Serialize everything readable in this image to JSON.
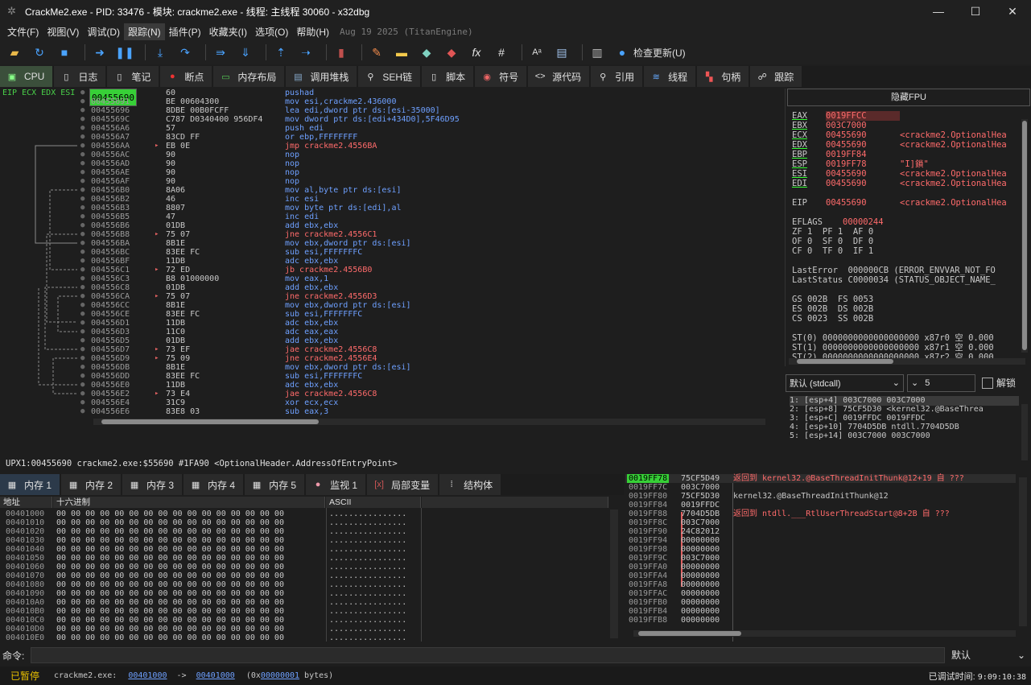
{
  "window": {
    "title": "CrackMe2.exe - PID: 33476 - 模块: crackme2.exe - 线程: 主线程 30060 - x32dbg",
    "minimize": "—",
    "maximize": "☐",
    "close": "✕"
  },
  "menu": {
    "items": [
      "文件(F)",
      "视图(V)",
      "调试(D)",
      "跟踪(N)",
      "插件(P)",
      "收藏夹(I)",
      "选项(O)",
      "帮助(H)"
    ],
    "active_index": 3,
    "date": "Aug 19 2025 (TitanEngine)"
  },
  "toolbar": {
    "update_label": "检查更新(U)",
    "icons": [
      "open-icon",
      "restart-icon",
      "stop-icon",
      "run-icon",
      "pause-icon",
      "step-into-icon",
      "step-over-icon",
      "trace-into-icon",
      "trace-over-icon",
      "execute-till-return-icon",
      "run-to-user-code-icon",
      "scylla-icon",
      "patch-icon",
      "comment-icon",
      "label-icon",
      "bookmark-icon",
      "function-icon",
      "hash-icon",
      "font-icon",
      "calculator-icon",
      "memo-icon",
      "globe-icon"
    ]
  },
  "tabs": [
    {
      "label": "CPU",
      "icon": "cpu-icon"
    },
    {
      "label": "日志",
      "icon": "log-icon"
    },
    {
      "label": "笔记",
      "icon": "notes-icon"
    },
    {
      "label": "断点",
      "icon": "breakpoint-icon"
    },
    {
      "label": "内存布局",
      "icon": "memory-map-icon"
    },
    {
      "label": "调用堆栈",
      "icon": "call-stack-icon"
    },
    {
      "label": "SEH链",
      "icon": "seh-icon"
    },
    {
      "label": "脚本",
      "icon": "script-icon"
    },
    {
      "label": "符号",
      "icon": "symbols-icon"
    },
    {
      "label": "源代码",
      "icon": "source-icon"
    },
    {
      "label": "引用",
      "icon": "references-icon"
    },
    {
      "label": "线程",
      "icon": "threads-icon"
    },
    {
      "label": "句柄",
      "icon": "handles-icon"
    },
    {
      "label": "跟踪",
      "icon": "trace-icon"
    }
  ],
  "disasm": {
    "reg_label": "EIP ECX EDX ESI",
    "rows": [
      {
        "addr": "00455690",
        "bytes": "60",
        "instr": "pushad",
        "type": "normal",
        "selected": true
      },
      {
        "addr": "00455691",
        "bytes": "BE 00604300",
        "instr": "mov esi,crackme2.436000",
        "type": "normal"
      },
      {
        "addr": "00455696",
        "bytes": "8DBE 00B0FCFF",
        "instr": "lea edi,dword ptr ds:[esi-35000]",
        "type": "normal"
      },
      {
        "addr": "0045569C",
        "bytes": "C787 D0340400 956DF4",
        "instr": "mov dword ptr ds:[edi+434D0],5F46D95",
        "type": "normal"
      },
      {
        "addr": "004556A6",
        "bytes": "57",
        "instr": "push edi",
        "type": "normal"
      },
      {
        "addr": "004556A7",
        "bytes": "83CD FF",
        "instr": "or ebp,FFFFFFFF",
        "type": "normal"
      },
      {
        "addr": "004556AA",
        "bytes": "EB 0E",
        "instr": "jmp crackme2.4556BA",
        "type": "jump"
      },
      {
        "addr": "004556AC",
        "bytes": "90",
        "instr": "nop",
        "type": "normal"
      },
      {
        "addr": "004556AD",
        "bytes": "90",
        "instr": "nop",
        "type": "normal"
      },
      {
        "addr": "004556AE",
        "bytes": "90",
        "instr": "nop",
        "type": "normal"
      },
      {
        "addr": "004556AF",
        "bytes": "90",
        "instr": "nop",
        "type": "normal"
      },
      {
        "addr": "004556B0",
        "bytes": "8A06",
        "instr": "mov al,byte ptr ds:[esi]",
        "type": "normal"
      },
      {
        "addr": "004556B2",
        "bytes": "46",
        "instr": "inc esi",
        "type": "normal"
      },
      {
        "addr": "004556B3",
        "bytes": "8807",
        "instr": "mov byte ptr ds:[edi],al",
        "type": "normal"
      },
      {
        "addr": "004556B5",
        "bytes": "47",
        "instr": "inc edi",
        "type": "normal"
      },
      {
        "addr": "004556B6",
        "bytes": "01DB",
        "instr": "add ebx,ebx",
        "type": "normal"
      },
      {
        "addr": "004556B8",
        "bytes": "75 07",
        "instr": "jne crackme2.4556C1",
        "type": "jump"
      },
      {
        "addr": "004556BA",
        "bytes": "8B1E",
        "instr": "mov ebx,dword ptr ds:[esi]",
        "type": "normal"
      },
      {
        "addr": "004556BC",
        "bytes": "83EE FC",
        "instr": "sub esi,FFFFFFFC",
        "type": "normal"
      },
      {
        "addr": "004556BF",
        "bytes": "11DB",
        "instr": "adc ebx,ebx",
        "type": "normal"
      },
      {
        "addr": "004556C1",
        "bytes": "72 ED",
        "instr": "jb crackme2.4556B0",
        "type": "jump"
      },
      {
        "addr": "004556C3",
        "bytes": "B8 01000000",
        "instr": "mov eax,1",
        "type": "normal"
      },
      {
        "addr": "004556C8",
        "bytes": "01DB",
        "instr": "add ebx,ebx",
        "type": "normal"
      },
      {
        "addr": "004556CA",
        "bytes": "75 07",
        "instr": "jne crackme2.4556D3",
        "type": "jump"
      },
      {
        "addr": "004556CC",
        "bytes": "8B1E",
        "instr": "mov ebx,dword ptr ds:[esi]",
        "type": "normal"
      },
      {
        "addr": "004556CE",
        "bytes": "83EE FC",
        "instr": "sub esi,FFFFFFFC",
        "type": "normal"
      },
      {
        "addr": "004556D1",
        "bytes": "11DB",
        "instr": "adc ebx,ebx",
        "type": "normal"
      },
      {
        "addr": "004556D3",
        "bytes": "11C0",
        "instr": "adc eax,eax",
        "type": "normal"
      },
      {
        "addr": "004556D5",
        "bytes": "01DB",
        "instr": "add ebx,ebx",
        "type": "normal"
      },
      {
        "addr": "004556D7",
        "bytes": "73 EF",
        "instr": "jae crackme2.4556C8",
        "type": "jump"
      },
      {
        "addr": "004556D9",
        "bytes": "75 09",
        "instr": "jne crackme2.4556E4",
        "type": "jump"
      },
      {
        "addr": "004556DB",
        "bytes": "8B1E",
        "instr": "mov ebx,dword ptr ds:[esi]",
        "type": "normal"
      },
      {
        "addr": "004556DD",
        "bytes": "83EE FC",
        "instr": "sub esi,FFFFFFFC",
        "type": "normal"
      },
      {
        "addr": "004556E0",
        "bytes": "11DB",
        "instr": "adc ebx,ebx",
        "type": "normal"
      },
      {
        "addr": "004556E2",
        "bytes": "73 E4",
        "instr": "jae crackme2.4556C8",
        "type": "jump"
      },
      {
        "addr": "004556E4",
        "bytes": "31C9",
        "instr": "xor ecx,ecx",
        "type": "normal"
      },
      {
        "addr": "004556E6",
        "bytes": "83E8 03",
        "instr": "sub eax,3",
        "type": "normal"
      }
    ]
  },
  "infobar": "UPX1:00455690 crackme2.exe:$55690 #1FA90 <OptionalHeader.AddressOfEntryPoint>",
  "registers": {
    "fpu_button": "隐藏FPU",
    "lines": [
      {
        "name": "EAX",
        "value": "0019FFCC",
        "comment": "",
        "changed": true,
        "hl": true
      },
      {
        "name": "EBX",
        "value": "003C7000",
        "comment": "",
        "changed": true
      },
      {
        "name": "ECX",
        "value": "00455690",
        "comment": "<crackme2.OptionalHea",
        "changed": true
      },
      {
        "name": "EDX",
        "value": "00455690",
        "comment": "<crackme2.OptionalHea",
        "changed": true
      },
      {
        "name": "EBP",
        "value": "0019FF84",
        "comment": "",
        "changed": true
      },
      {
        "name": "ESP",
        "value": "0019FF78",
        "comment": "\"I]鎖\"",
        "changed": true
      },
      {
        "name": "ESI",
        "value": "00455690",
        "comment": "<crackme2.OptionalHea",
        "changed": true
      },
      {
        "name": "EDI",
        "value": "00455690",
        "comment": "<crackme2.OptionalHea",
        "changed": true
      },
      {
        "name": "",
        "value": "",
        "comment": ""
      },
      {
        "name": "EIP",
        "value": "00455690",
        "comment": "<crackme2.OptionalHea"
      },
      {
        "name": "",
        "value": "",
        "comment": ""
      },
      {
        "name": "EFLAGS",
        "value": "00000244",
        "comment": ""
      },
      {
        "text": "ZF 1  PF 1  AF 0"
      },
      {
        "text": "OF 0  SF 0  DF 0"
      },
      {
        "text": "CF 0  TF 0  IF 1"
      },
      {
        "name": "",
        "value": "",
        "comment": ""
      },
      {
        "text": "LastError  000000CB (ERROR_ENVVAR_NOT_FO"
      },
      {
        "text": "LastStatus C0000034 (STATUS_OBJECT_NAME_"
      },
      {
        "name": "",
        "value": "",
        "comment": ""
      },
      {
        "text": "GS 002B  FS 0053"
      },
      {
        "text": "ES 002B  DS 002B"
      },
      {
        "text": "CS 0023  SS 002B"
      },
      {
        "name": "",
        "value": "",
        "comment": ""
      },
      {
        "text": "ST(0) 0000000000000000000 x87r0 空 0.000"
      },
      {
        "text": "ST(1) 0000000000000000000 x87r1 空 0.000"
      },
      {
        "text": "ST(2) 0000000000000000000 x87r2 空 0.000"
      }
    ]
  },
  "callconv": {
    "selected": "默认 (stdcall)",
    "count": "5",
    "unlock_label": "解锁"
  },
  "stack_args": [
    "1: [esp+4] 003C7000 003C7000",
    "2: [esp+8] 75CF5D30 <kernel32.@BaseThrea",
    "3: [esp+C] 0019FFDC 0019FFDC",
    "4: [esp+10] 7704D5DB ntdll.7704D5DB",
    "5: [esp+14] 003C7000 003C7000"
  ],
  "mem_tabs": [
    {
      "label": "内存 1",
      "icon": "memory-icon"
    },
    {
      "label": "内存 2",
      "icon": "memory-icon"
    },
    {
      "label": "内存 3",
      "icon": "memory-icon"
    },
    {
      "label": "内存 4",
      "icon": "memory-icon"
    },
    {
      "label": "内存 5",
      "icon": "memory-icon"
    },
    {
      "label": "监视 1",
      "icon": "watch-icon"
    },
    {
      "label": "局部变量",
      "icon": "locals-icon"
    },
    {
      "label": "结构体",
      "icon": "struct-icon"
    }
  ],
  "dump": {
    "headers": {
      "addr": "地址",
      "hex": "十六进制",
      "ascii": "ASCII"
    },
    "hex": "00 00 00 00 00 00 00 00 00 00 00 00 00 00 00 00",
    "ascii": "................",
    "rows": [
      "00401000",
      "00401010",
      "00401020",
      "00401030",
      "00401040",
      "00401050",
      "00401060",
      "00401070",
      "00401080",
      "00401090",
      "004010A0",
      "004010B0",
      "004010C0",
      "004010D0",
      "004010E0"
    ]
  },
  "stack": [
    {
      "addr": "0019FF78",
      "val": "75CF5D49",
      "cmt": "返回到 kernel32.@BaseThreadInitThunk@12+19 自 ???",
      "top": true
    },
    {
      "addr": "0019FF7C",
      "val": "003C7000",
      "cmt": ""
    },
    {
      "addr": "0019FF80",
      "val": "75CF5D30",
      "cmt": "kernel32.@BaseThreadInitThunk@12",
      "plain": true
    },
    {
      "addr": "0019FF84",
      "val": "0019FFDC",
      "cmt": ""
    },
    {
      "addr": "0019FF88",
      "val": "7704D5DB",
      "cmt": "返回到 ntdll.___RtlUserThreadStart@8+2B 自 ???"
    },
    {
      "addr": "0019FF8C",
      "val": "003C7000",
      "cmt": ""
    },
    {
      "addr": "0019FF90",
      "val": "24C82012",
      "cmt": ""
    },
    {
      "addr": "0019FF94",
      "val": "00000000",
      "cmt": ""
    },
    {
      "addr": "0019FF98",
      "val": "00000000",
      "cmt": ""
    },
    {
      "addr": "0019FF9C",
      "val": "003C7000",
      "cmt": ""
    },
    {
      "addr": "0019FFA0",
      "val": "00000000",
      "cmt": ""
    },
    {
      "addr": "0019FFA4",
      "val": "00000000",
      "cmt": ""
    },
    {
      "addr": "0019FFA8",
      "val": "00000000",
      "cmt": ""
    },
    {
      "addr": "0019FFAC",
      "val": "00000000",
      "cmt": ""
    },
    {
      "addr": "0019FFB0",
      "val": "00000000",
      "cmt": ""
    },
    {
      "addr": "0019FFB4",
      "val": "00000000",
      "cmt": ""
    },
    {
      "addr": "0019FFB8",
      "val": "00000000",
      "cmt": ""
    }
  ],
  "command": {
    "label": "命令:",
    "placeholder": "",
    "default": "默认"
  },
  "status": {
    "state": "已暂停",
    "module": "crackme2.exe:",
    "from": "00401000",
    "arrow": "->",
    "to": "00401000",
    "size_pre": "(0x",
    "size": "00000001",
    "size_post": "bytes)",
    "debug_time_label": "已调试时间:",
    "debug_time": "9:09:10:38"
  }
}
